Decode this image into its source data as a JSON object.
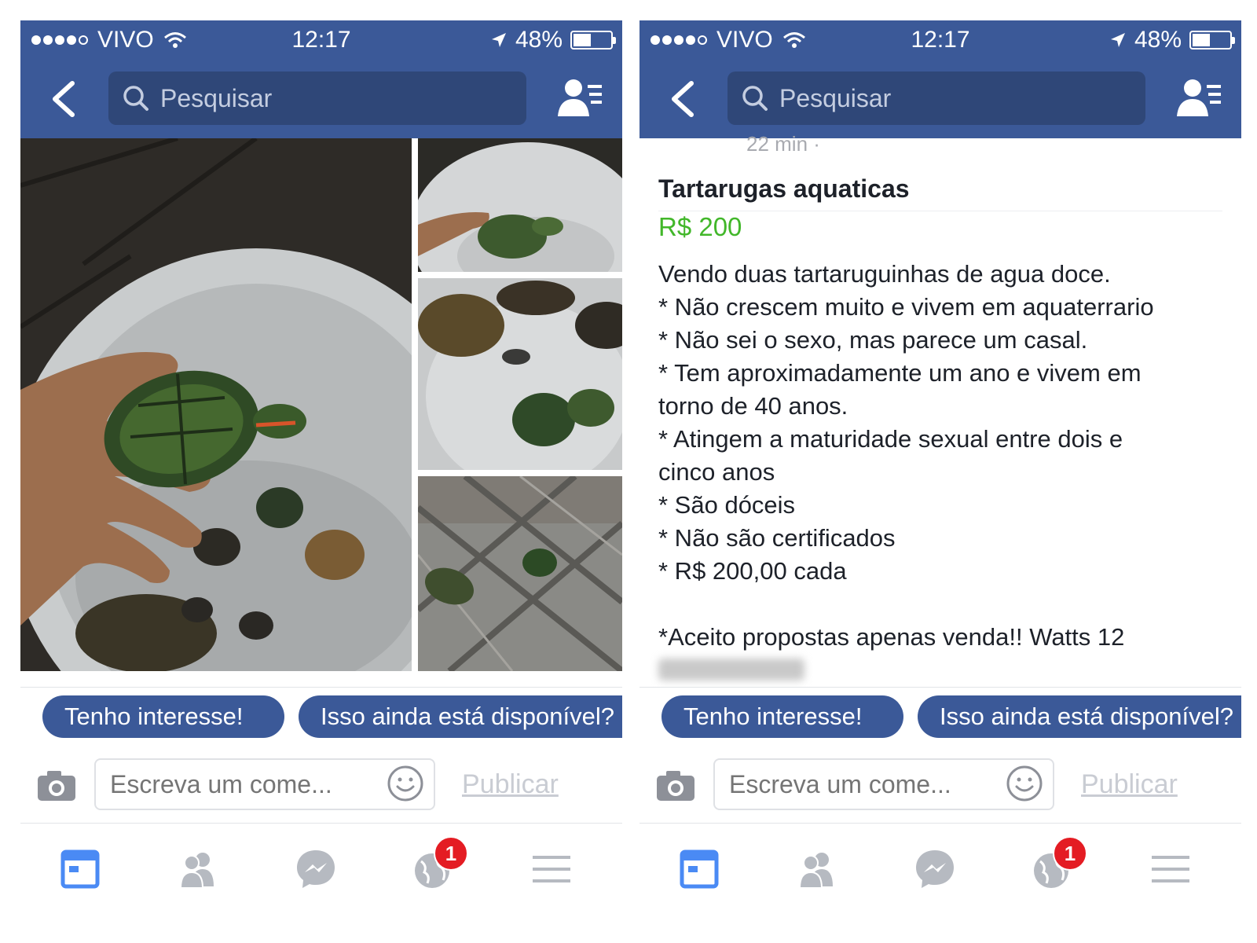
{
  "status_bar": {
    "carrier": "VIVO",
    "time": "12:17",
    "battery": "48%",
    "battery_level": 0.48
  },
  "nav": {
    "search_placeholder": "Pesquisar"
  },
  "post": {
    "timestamp": "22 min ·",
    "title": "Tartarugas aquaticas",
    "price": "R$ 200",
    "body": [
      "Vendo duas tartaruguinhas de agua doce.",
      "* Não crescem muito e vivem em aquaterrario",
      "* Não sei o sexo, mas parece um casal.",
      "* Tem aproximadamente um ano e vivem em",
      "torno de 40 anos.",
      "*  Atingem a maturidade sexual entre dois e",
      "cinco anos",
      "* São dóceis",
      "* Não são certificados",
      "* R$ 200,00 cada"
    ],
    "closing": "*Aceito propostas apenas venda!! Watts 12"
  },
  "quick_replies": {
    "first": "Tenho interesse!",
    "second": "Isso ainda está disponível?"
  },
  "comment": {
    "placeholder": "Escreva um come...",
    "publish_label": "Publicar"
  },
  "tabs": {
    "notifications_badge": "1"
  },
  "colors": {
    "brand_blue": "#3b5998",
    "price_green": "#42b72a",
    "badge_red": "#e41c23",
    "active_tab": "#4a8af4",
    "inactive_tab": "#b6bac1"
  }
}
